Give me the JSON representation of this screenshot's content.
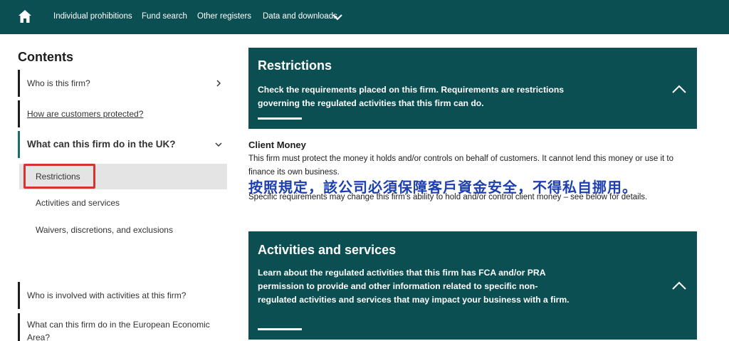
{
  "nav": {
    "home_icon": "home-icon",
    "items": [
      "Individual prohibitions",
      "Fund search",
      "Other registers",
      "Data and downloads"
    ],
    "dropdown_icon": "chevron-down-icon"
  },
  "sidebar": {
    "title": "Contents",
    "items": [
      {
        "label": "Who is this firm?",
        "icon": "chevron-right-icon"
      },
      {
        "label": "How are customers protected?"
      },
      {
        "label": "What can this firm do in the UK?",
        "icon": "chevron-down-icon"
      }
    ],
    "sub_items": [
      "Restrictions",
      "Activities and services",
      "Waivers, discretions, and exclusions"
    ],
    "lower_items": [
      "Who is involved with activities at this firm?",
      "What can this firm do in the European Economic Area?"
    ]
  },
  "restrictions": {
    "title": "Restrictions",
    "description": "Check the requirements placed on this firm. Requirements are restrictions governing the regulated activities that this firm can do.",
    "toggle_icon": "chevron-up-icon"
  },
  "client_money": {
    "title": "Client Money",
    "body": "This firm must protect the money it holds and/or controls on behalf of customers. It cannot lend this money or use it to finance its own business.",
    "annotation": "按照規定，該公司必須保障客戶資金安全，不得私自挪用。",
    "note": "Specific requirements may change this firm's ability to hold and/or control client money – see below for details."
  },
  "activities": {
    "title": "Activities and services",
    "description": "Learn about the regulated activities that this firm has FCA and/or PRA permission to provide and other information related to specific non-regulated activities and services that may impact your business with a firm.",
    "toggle_icon": "chevron-up-icon"
  },
  "colors": {
    "brand": "#0b4f52",
    "highlight": "#d9322c",
    "annotation": "#1d3fb0"
  }
}
